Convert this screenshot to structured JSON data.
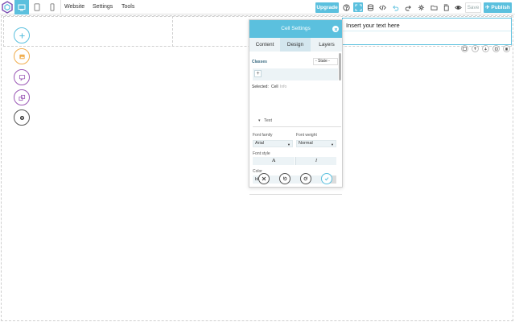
{
  "topbar": {
    "menu": [
      "Website",
      "Settings",
      "Tools"
    ],
    "upgrade_label": "Upgrade",
    "save_label": "Save",
    "publish_label": "Publish"
  },
  "canvas": {
    "text_cell_text": "Insert your text here"
  },
  "panel": {
    "title": "Cell Settings",
    "tabs": [
      "Content",
      "Design",
      "Layers"
    ],
    "active_tab": "Design",
    "classes_label": "Classes",
    "state_value": "- State -",
    "classes_add": "+",
    "selected_label": "Selected:",
    "selected_value": "Cell",
    "selected_extra": "Info",
    "section_text": "Text",
    "font_family_label": "Font family",
    "font_family_value": "Arial",
    "font_weight_label": "Font weight",
    "font_weight_value": "Normal",
    "font_style_label": "Font style",
    "font_style_normal": "A",
    "font_style_italic": "I",
    "color_label": "Color",
    "color_value": "black"
  },
  "colors": {
    "accent": "#5bc0de",
    "add_button": "#5bc0de",
    "image_button": "#f0ad4e",
    "text_button": "#9b59b6",
    "layout_button": "#9b59b6",
    "settings_button": "#333333",
    "confirm": "#5bc0de"
  }
}
